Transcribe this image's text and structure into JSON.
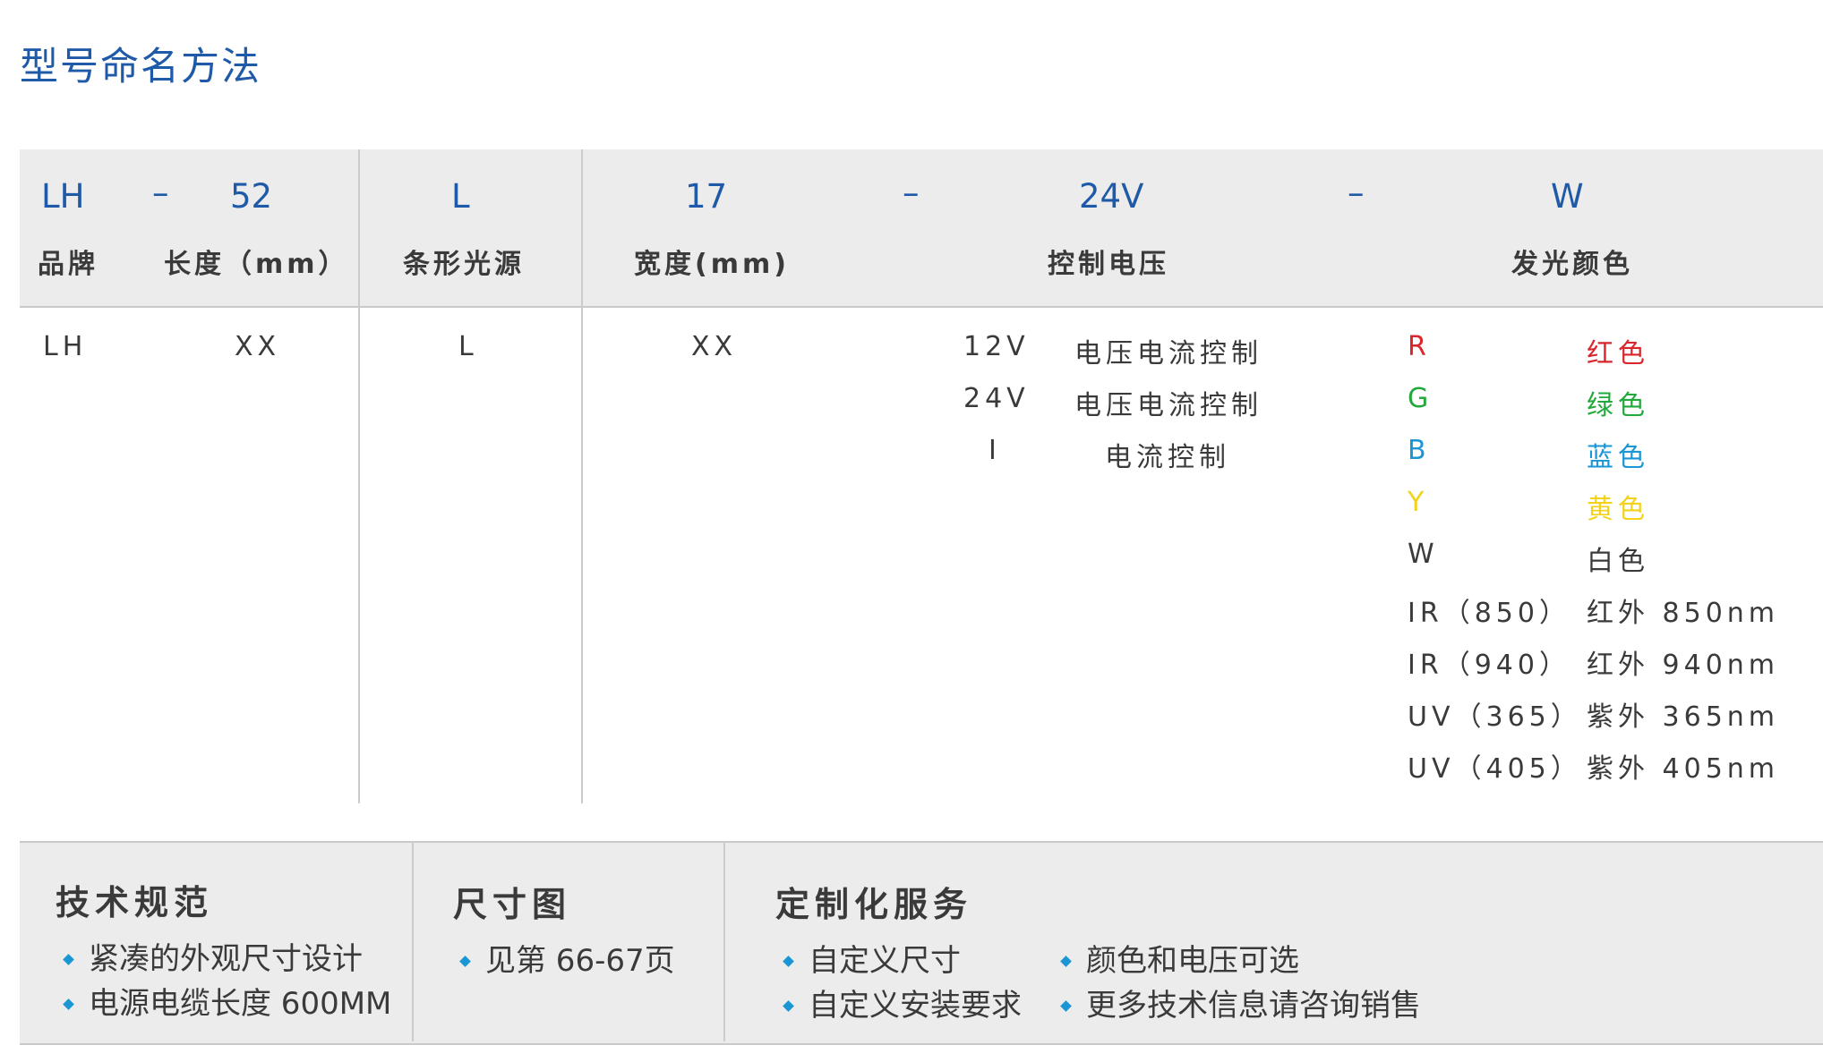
{
  "title": "型号命名方法",
  "naming": {
    "codes": {
      "brand": "LH",
      "dash1": "–",
      "length": "52",
      "type": "L",
      "width": "17",
      "dash2": "–",
      "voltage": "24V",
      "dash3": "–",
      "color": "W"
    },
    "labels": {
      "brand": "品牌",
      "length": "长度（mm）",
      "type": "条形光源",
      "width": "宽度(mm)",
      "voltage": "控制电压",
      "color": "发光颜色"
    },
    "values": {
      "brand": "LH",
      "length": "XX",
      "type": "L",
      "width": "XX"
    },
    "voltage_options": [
      {
        "code": "12V",
        "desc": "电压电流控制"
      },
      {
        "code": "24V",
        "desc": "电压电流控制"
      },
      {
        "code": "I",
        "desc": "电流控制"
      }
    ],
    "color_options": [
      {
        "code": "R",
        "name": "红色",
        "color": "#d8262c"
      },
      {
        "code": "G",
        "name": "绿色",
        "color": "#22a83b"
      },
      {
        "code": "B",
        "name": "蓝色",
        "color": "#1a96d4"
      },
      {
        "code": "Y",
        "name": "黄色",
        "color": "#f2d21b"
      },
      {
        "code": "W",
        "name": "白色",
        "color": "#3a3a3a"
      },
      {
        "code": "IR（850）",
        "name": "红外 850nm",
        "color": "#3a3a3a"
      },
      {
        "code": "IR（940）",
        "name": "红外 940nm",
        "color": "#3a3a3a"
      },
      {
        "code": "UV（365）",
        "name": "紫外 365nm",
        "color": "#3a3a3a"
      },
      {
        "code": "UV（405）",
        "name": "紫外 405nm",
        "color": "#3a3a3a"
      }
    ]
  },
  "info": {
    "spec": {
      "heading": "技术规范",
      "items": [
        "紧凑的外观尺寸设计",
        "电源电缆长度 600MM"
      ]
    },
    "dimension": {
      "heading": "尺寸图",
      "items": [
        "见第 66-67页"
      ]
    },
    "custom": {
      "heading": "定制化服务",
      "items_left": [
        "自定义尺寸",
        "自定义安装要求"
      ],
      "items_right": [
        "颜色和电压可选",
        "更多技术信息请咨询销售"
      ]
    }
  },
  "colors": {
    "accent": "#1f5aa8",
    "panel_bg": "#ececec",
    "bullet": "#1a96d4"
  }
}
